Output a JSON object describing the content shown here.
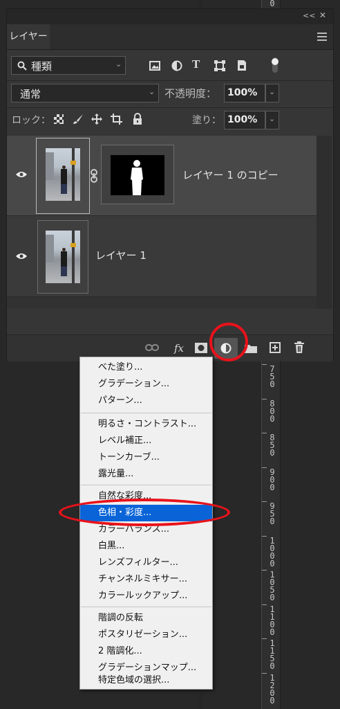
{
  "panel": {
    "collapse_label": "<<",
    "close_label": "✕",
    "tab_label": "レイヤー",
    "filter": {
      "search_icon": "search-icon",
      "value": "種類"
    },
    "blend_mode": "通常",
    "opacity_label": "不透明度：",
    "opacity_value": "100%",
    "lock_label": "ロック：",
    "fill_label": "塗り：",
    "fill_value": "100%"
  },
  "layers": [
    {
      "name": "レイヤー 1 のコピー",
      "visible": true,
      "has_mask": true,
      "selected": true
    },
    {
      "name": "レイヤー 1",
      "visible": true,
      "has_mask": false,
      "selected": false
    }
  ],
  "footer": {
    "fx_label": "fx"
  },
  "menu": {
    "group1": [
      "べた塗り...",
      "グラデーション...",
      "パターン..."
    ],
    "group2": [
      "明るさ・コントラスト...",
      "レベル補正...",
      "トーンカーブ...",
      "露光量..."
    ],
    "group3": [
      "自然な彩度...",
      "色相・彩度...",
      "カラーバランス...",
      "白黒...",
      "レンズフィルター...",
      "チャンネルミキサー...",
      "カラールックアップ..."
    ],
    "group4": [
      "階調の反転",
      "ポスタリゼーション...",
      "2 階調化...",
      "グラデーションマップ...",
      "特定色域の選択..."
    ],
    "selected_item": "色相・彩度..."
  },
  "ruler": {
    "labels": [
      "750",
      "800",
      "850",
      "900",
      "950",
      "1000",
      "1050",
      "1100",
      "1150",
      "1200"
    ],
    "top_partial": "0"
  },
  "colors": {
    "highlight": "#0a64d8",
    "annotation": "#e8121b",
    "panel_bg": "#363636"
  }
}
